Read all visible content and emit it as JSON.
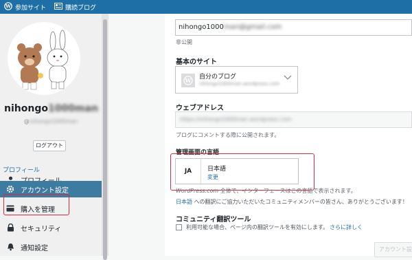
{
  "topbar": {
    "item1_label": "参加サイト",
    "item2_label": "購読ブログ",
    "background": "#1d6fa5"
  },
  "sidebar": {
    "username_visible": "nihongo",
    "username_blurred": "1000man",
    "handle_visible": "@",
    "handle_blurred": "nihongo1000man",
    "logout_label": "ログアウト",
    "section_label": "プロフィール",
    "items": [
      {
        "label": "プロフィール",
        "icon": "person-icon"
      },
      {
        "label": "アカウント設定",
        "icon": "gear-icon"
      },
      {
        "label": "購入を管理",
        "icon": "card-icon"
      },
      {
        "label": "セキュリティ",
        "icon": "lock-icon"
      },
      {
        "label": "通知設定",
        "icon": "bell-icon"
      }
    ],
    "active_color": "#3d7ba1"
  },
  "account": {
    "email_visible": "nihongo1000",
    "email_blurred": "man@gmail.com",
    "email_note": "非公開",
    "primary_site_label": "基本のサイト",
    "site_name": "自分のブログ",
    "site_url_blurred": "nihongo1000man.wordpress.com",
    "web_address_label": "ウェブアドレス",
    "web_address_blurred": "https://nihongo1000man.wordpress.com",
    "web_address_note": "ブログにコメントする際に公開されます。",
    "interface_language_label": "管理画面の言語",
    "language_code": "JA",
    "language_name": "日本語",
    "language_change": "変更",
    "language_note_italic": "WordPress.com",
    "language_note_rest": " 全体で、インターフェースはこの言語で表示されます。",
    "translation_link_text": "日本語",
    "translation_note": " への翻訳にご協力いただいたコミュニティメンバーの皆さん、ありがとうございます！",
    "community_label": "コミュニティ翻訳ツール",
    "community_checkbox_text": "利用可能な場合、ページ内の翻訳ツールを有効にします。",
    "community_learn_more": "さらに詳しく",
    "save_label": "アカウント設定を保存"
  },
  "colors": {
    "highlight_border": "#e0283c",
    "link": "#1d6fa5"
  }
}
